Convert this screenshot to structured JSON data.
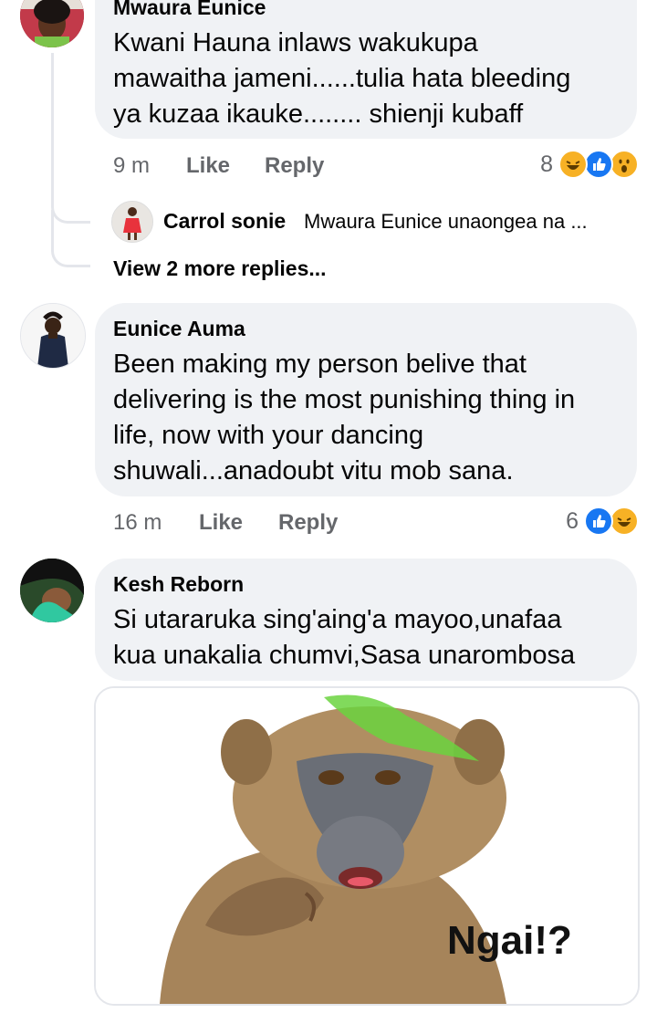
{
  "comments": [
    {
      "author": "Mwaura Eunice",
      "lines": [
        "Kwani Hauna inlaws wakukupa",
        "mawaitha jameni......tulia hata bleeding",
        "ya kuzaa ikauke........ shienji kubaff"
      ],
      "time": "9 m",
      "like": "Like",
      "reply": "Reply",
      "reaction_count": "8",
      "reactions": [
        "haha-icon",
        "like-icon",
        "wow-icon"
      ]
    },
    {
      "author": "Eunice Auma",
      "lines": [
        "Been making my person belive that",
        "delivering is the most punishing thing in",
        "life, now with your dancing",
        "shuwali...anadoubt vitu mob sana."
      ],
      "time": "16 m",
      "like": "Like",
      "reply": "Reply",
      "reaction_count": "6",
      "reactions": [
        "like-icon",
        "haha-icon"
      ]
    },
    {
      "author": "Kesh Reborn",
      "lines": [
        "Si utararuka  sing'aing'a mayoo,unafaa",
        "kua unakalia chumvi,Sasa unarombosa"
      ],
      "image_caption": "Ngai!?"
    }
  ],
  "reply_preview": {
    "author": "Carrol sonie",
    "text": "Mwaura Eunice  unaongea na ..."
  },
  "view_more": "View 2 more replies...",
  "colors": {
    "bubble": "#f0f2f5",
    "meta": "#65676b",
    "like_blue": "#1877f2",
    "haha_yellow": "#f7b125",
    "thread": "#e4e6eb"
  }
}
